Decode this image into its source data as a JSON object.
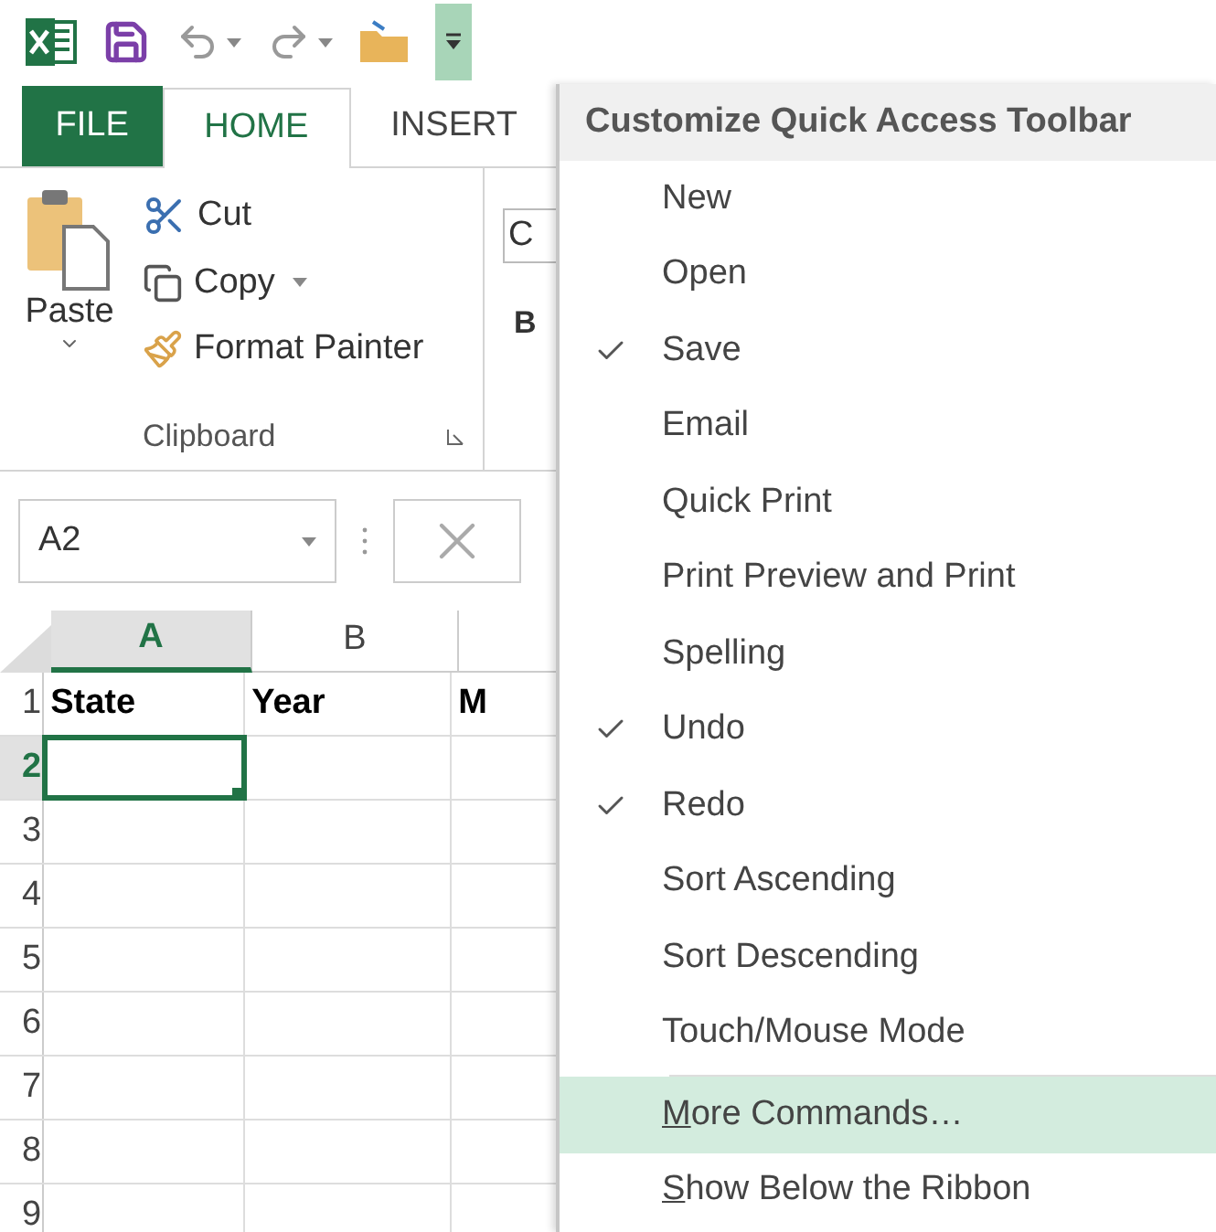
{
  "tabs": [
    {
      "label": "FILE",
      "kind": "file",
      "selected": false
    },
    {
      "label": "HOME",
      "kind": "tab",
      "selected": true
    },
    {
      "label": "INSERT",
      "kind": "tab",
      "selected": false
    }
  ],
  "clipboard": {
    "paste": "Paste",
    "cut": "Cut",
    "copy": "Copy",
    "format_painter": "Format Painter",
    "group_label": "Clipboard"
  },
  "font_group": {
    "font_field": "C",
    "bold": "B"
  },
  "name_box": {
    "value": "A2"
  },
  "grid": {
    "columns": [
      {
        "label": "A",
        "selected": true
      },
      {
        "label": "B",
        "selected": false
      },
      {
        "selected": false
      }
    ],
    "rows": [
      {
        "label": "1",
        "selected": false,
        "cells": [
          "State",
          "Year",
          "M"
        ]
      },
      {
        "label": "2",
        "selected": true,
        "cells": [
          "",
          "",
          ""
        ]
      },
      {
        "label": "3",
        "selected": false,
        "cells": [
          "",
          "",
          ""
        ]
      },
      {
        "label": "4",
        "selected": false,
        "cells": [
          "",
          "",
          ""
        ]
      },
      {
        "label": "5",
        "selected": false,
        "cells": [
          "",
          "",
          ""
        ]
      },
      {
        "label": "6",
        "selected": false,
        "cells": [
          "",
          "",
          ""
        ]
      },
      {
        "label": "7",
        "selected": false,
        "cells": [
          "",
          "",
          ""
        ]
      },
      {
        "label": "8",
        "selected": false,
        "cells": [
          "",
          "",
          ""
        ]
      },
      {
        "label": "9",
        "selected": false,
        "cells": [
          "",
          "",
          ""
        ]
      }
    ]
  },
  "menu": {
    "title": "Customize Quick Access Toolbar",
    "items": [
      {
        "label": "New",
        "checked": false,
        "kind": "toggle"
      },
      {
        "label": "Open",
        "checked": false,
        "kind": "toggle"
      },
      {
        "label": "Save",
        "checked": true,
        "kind": "toggle"
      },
      {
        "label": "Email",
        "checked": false,
        "kind": "toggle"
      },
      {
        "label": "Quick Print",
        "checked": false,
        "kind": "toggle"
      },
      {
        "label": "Print Preview and Print",
        "checked": false,
        "kind": "toggle"
      },
      {
        "label": "Spelling",
        "checked": false,
        "kind": "toggle"
      },
      {
        "label": "Undo",
        "checked": true,
        "kind": "toggle"
      },
      {
        "label": "Redo",
        "checked": true,
        "kind": "toggle"
      },
      {
        "label": "Sort Ascending",
        "checked": false,
        "kind": "toggle"
      },
      {
        "label": "Sort Descending",
        "checked": false,
        "kind": "toggle"
      },
      {
        "label": "Touch/Mouse Mode",
        "checked": false,
        "kind": "toggle"
      },
      {
        "label": "More Commands…",
        "kind": "command",
        "selected": true,
        "underline_first": true
      },
      {
        "label": "Show Below the Ribbon",
        "kind": "command",
        "selected": false,
        "underline_first": true
      }
    ]
  }
}
